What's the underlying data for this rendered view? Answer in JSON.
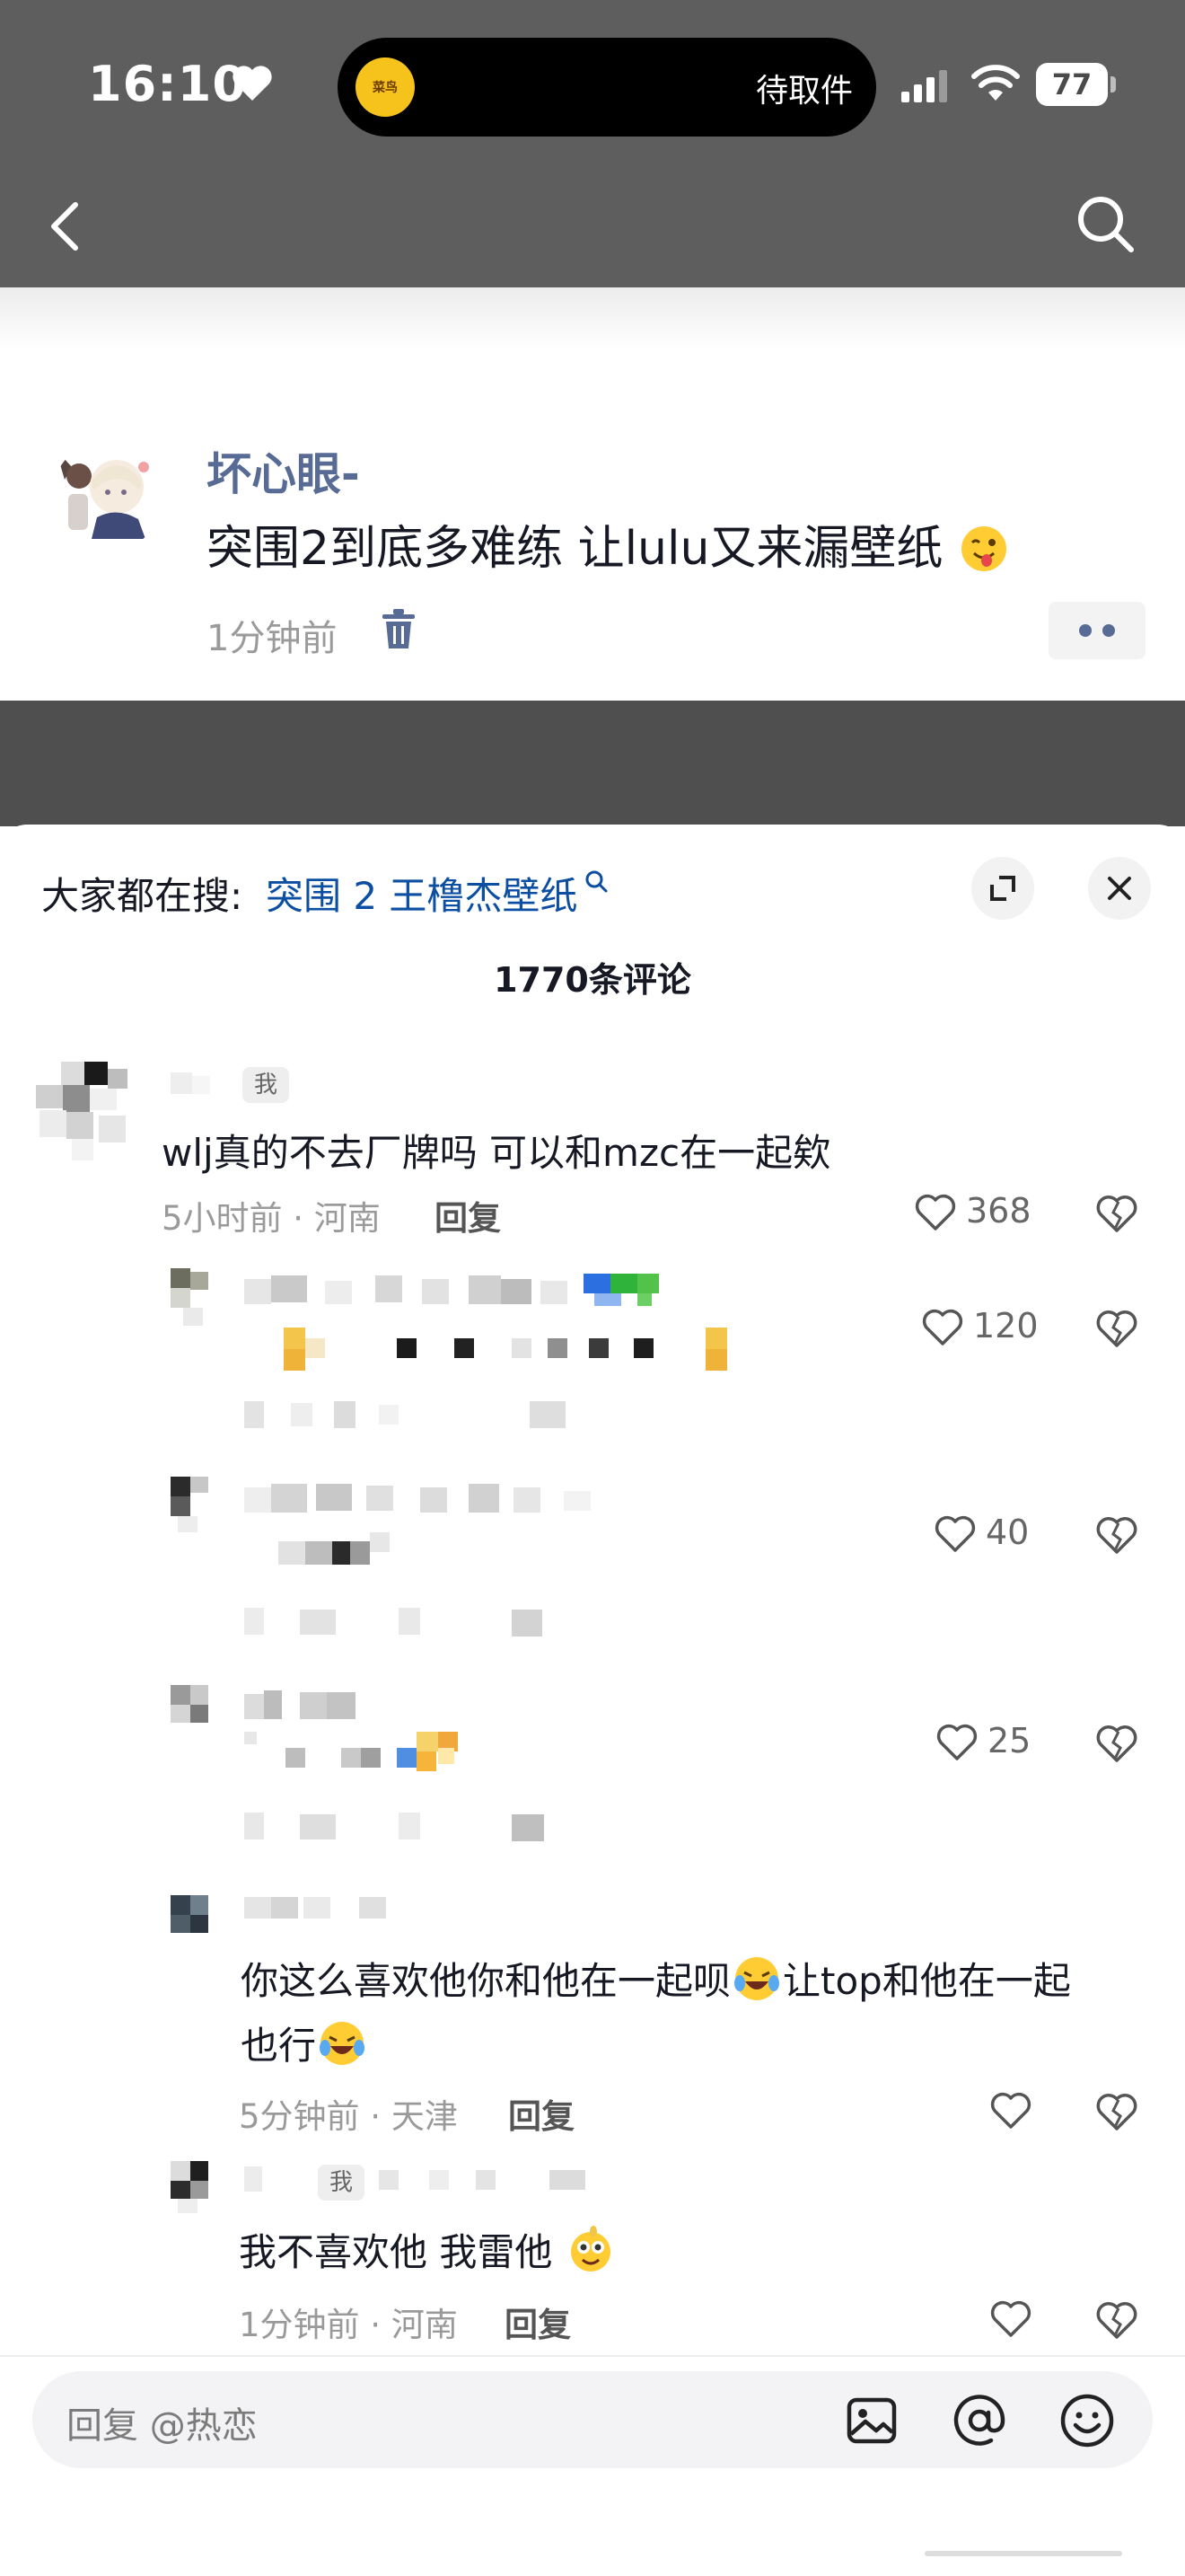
{
  "status_bar": {
    "time": "16:10",
    "island_logo_text": "菜鸟",
    "island_text": "待取件",
    "battery": "77"
  },
  "post": {
    "username": "坏心眼-",
    "text": "突围2到底多难练 让lulu又来漏壁纸",
    "time": "1分钟前"
  },
  "sheet": {
    "hot_label": "大家都在搜:",
    "hot_link": "突围 2 王橹杰壁纸",
    "comment_count": "1770条评论"
  },
  "comments": [
    {
      "me_badge": "我",
      "text": "wlj真的不去厂牌吗 可以和mzc在一起欸",
      "meta": "5小时前 · 河南",
      "reply": "回复",
      "likes": "368"
    },
    {
      "likes": "120"
    },
    {
      "likes": "40"
    },
    {
      "likes": "25"
    },
    {
      "text_line1": "你这么喜欢他你和他在一起呗",
      "text_line1b": "让top和他在一起",
      "text_line2": "也行",
      "meta": "5分钟前 · 天津",
      "reply": "回复"
    },
    {
      "me_badge": "我",
      "text": "我不喜欢他 我雷他",
      "meta": "1分钟前 · 河南",
      "reply": "回复"
    }
  ],
  "reply_bar": {
    "placeholder": "回复 @热恋"
  },
  "colors": {
    "link_blue": "#0b4ea2",
    "username_blue": "#576b95",
    "header_gray": "#5e5e5e"
  }
}
